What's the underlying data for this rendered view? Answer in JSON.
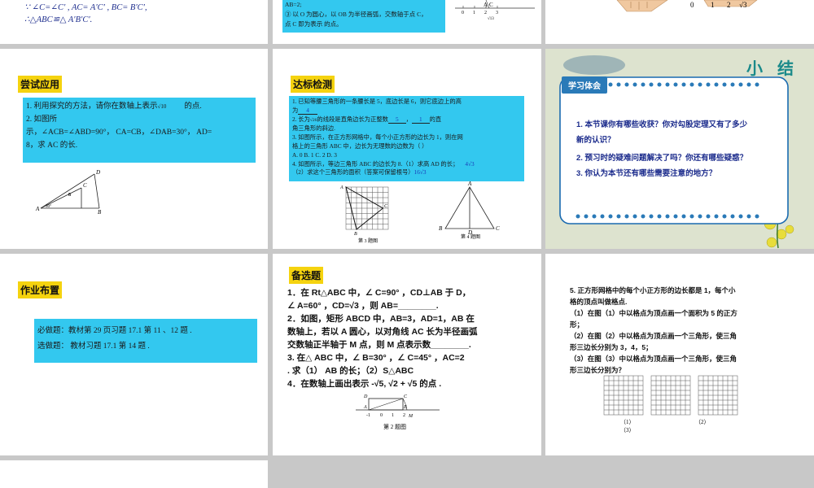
{
  "top_left": {
    "line1": "∵ ∠C=∠C′ ,      AC= A′C′ ,      BC= B′C′,",
    "line2": "∴△ABC≌△ A′B′C′."
  },
  "top_middle": {
    "line1": "AB=2;",
    "line2": "③ 以 O 为圆心，以 OB 为半径画弧，交数轴于点 C，",
    "line3": "点 C 即为表示               的点。",
    "axis_labels": [
      "0",
      "1",
      "2",
      "3",
      "√13",
      "A",
      "C"
    ]
  },
  "top_right": {
    "axis_labels": [
      "0",
      "1",
      "2",
      "√3"
    ]
  },
  "slide1": {
    "title": "尝试应用",
    "q1": "1. 利用探究的方法，请你在数轴上表示",
    "q1_sqrt": "√10",
    "q1_end": "的点.",
    "q2a": "2. 如图所",
    "q2b": "示，∠ACB=∠ABD=90°， CA=CB，∠DAB=30°， AD=",
    "q2c": "8，求 AC 的长.",
    "fig_labels": {
      "d": "D",
      "c": "C",
      "a": "A",
      "b": "B",
      "eight": "8",
      "angle": "30°"
    }
  },
  "slide2": {
    "title": "达标检测",
    "l1": "1. 已知等腰三角形的一条腰长是 5，底边长是 6，则它底边上的高",
    "l2": "为",
    "a1": "4",
    "l3": "2. 长为",
    "l3_sqrt": "√26",
    "l3b": "的线段是直角边长为正整数",
    "a2": "5",
    "a3": "1",
    "l3c": "的直",
    "l4": "角三角形的斜边.",
    "l5": "3. 如图所示，在正方形网格中，每个小正方形的边长为 1，则在网",
    "l6": "格上的三角形 ABC 中，边长为无理数的边数为（      ）",
    "opts": "A. 0               B. 1               C. 2               D. 3",
    "l7": "4. 如图所示，等边三角形 ABC 的边长为 8.（1）求高 AD 的长；",
    "a4": "4√3",
    "l8": "（2）求这个三角形的面积（答案可保留根号）",
    "a5": "16√3",
    "cap3": "第 3 题图",
    "cap4": "第 4 题图",
    "fig_labels": {
      "a": "A",
      "b": "B",
      "c": "C",
      "d": "D"
    }
  },
  "slide3": {
    "banner": "学习体会",
    "deco": "小结",
    "q1": "1. 本节课你有哪些收获？你对勾股定理又有了多少",
    "q1b": "新的认识？",
    "q2": "2. 预习时的疑难问题解决了吗？你还有哪些疑惑？",
    "q3": "3. 你认为本节还有哪些需要注意的地方？"
  },
  "slide4": {
    "title": "作业布置",
    "l1": "必做题：教材第 29 页习题 17.1 第 11 、12 题 .",
    "l2": "选做题：  教材习题 17.1 第 14 题 ."
  },
  "slide5": {
    "title": "备选题",
    "l1": "1．在 Rt△ABC 中，∠ C=90°  ，CD⊥AB 于 D，",
    "l2": "∠ A=60°  ，CD=√3  ，则 AB=________.",
    "l3": "2．如图，矩形 ABCD 中，AB=3，AD=1，AB 在",
    "l4": "数轴上，若以 A 圆心，以对角线 AC 长为半径画弧",
    "l5": "交数轴正半轴于 M 点，则 M 点表示数________.",
    "l6": "3. 在△ ABC 中，∠ B=30°  ，∠ C=45°  ，AC=2",
    "l7": ". 求（1） AB 的长；（2）S△ABC",
    "l8": "4．在数轴上画出表示 -√5, √2 + √5 的点 .",
    "cap": "第 2 题图",
    "fig_labels": {
      "d": "D",
      "c": "C",
      "a": "A",
      "b": "B",
      "m": "M",
      "n1": "-1",
      "n0": "0",
      "n1p": "1",
      "n2": "2"
    }
  },
  "slide6": {
    "l1": "5.   正方形网格中的每个小正方形的边长都是 1，每个小",
    "l2": "格的顶点叫做格点.",
    "l3": "（1）在图（1）中以格点为顶点画一个面积为 5 的正方",
    "l4": "形；",
    "l5": "（2）在图（2）中以格点为顶点画一个三角形，使三角",
    "l6": "形三边长分别为 3，4，5；",
    "l7": "（3）在图（3）中以格点为顶点画一个三角形，使三角",
    "l8": "形三边长分别为？",
    "cap1": "（1）",
    "cap2": "（2）",
    "cap3": "（3）"
  },
  "colors": {
    "highlight": "#f5d30f",
    "cyan": "#33c8ef",
    "summary_bg": "#dde3cf",
    "blue_text": "#1b2b8c",
    "answer": "#1a3ab8",
    "gap": "#c8c8c8"
  }
}
